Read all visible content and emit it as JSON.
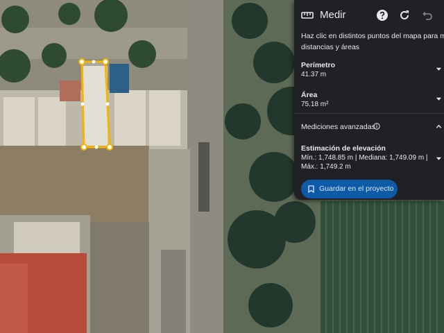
{
  "panel": {
    "title": "Medir",
    "description_line1": "Haz clic en distintos puntos del mapa para medir",
    "description_line2": "distancias y áreas",
    "perimeter": {
      "label": "Perímetro",
      "value": "41.37 m"
    },
    "area": {
      "label": "Área",
      "value": "75.18 m²"
    },
    "advanced": {
      "label": "Mediciones avanzadas"
    },
    "elevation": {
      "label": "Estimación de elevación",
      "line1": "Mín.: 1,748.85 m | Mediana: 1,749.09 m |",
      "line2": "Máx.: 1,749.2 m"
    },
    "save_button": "Guardar en el proyecto",
    "icons": [
      "ruler-icon",
      "help-icon",
      "refresh-icon",
      "undo-icon",
      "chevron-down-icon",
      "chevron-up-icon",
      "info-icon",
      "bookmark-icon"
    ]
  },
  "colors": {
    "panel_bg": "#202124",
    "accent_blue": "#0d5aa7",
    "measure_outline": "#f4b400"
  }
}
